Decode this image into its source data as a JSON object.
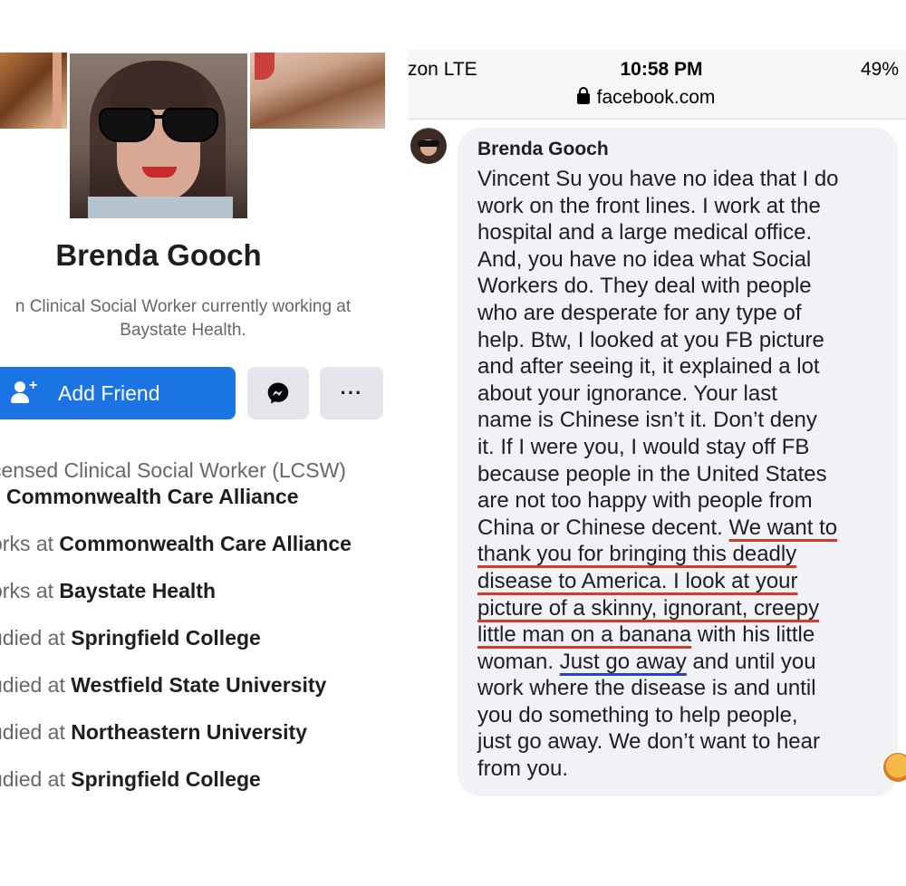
{
  "profile": {
    "name": "Brenda Gooch",
    "bio_line1": "n Clinical Social Worker currently working at",
    "bio_line2": "Baystate Health.",
    "add_friend_label": "Add Friend",
    "more_label": "···",
    "icons": {
      "add_friend": "person-plus-icon",
      "messenger": "messenger-icon",
      "more": "more-icon"
    },
    "colors": {
      "primary_button": "#1b74e4",
      "secondary_button": "#e4e6eb"
    },
    "about": [
      {
        "prefix": "censed Clinical Social Worker (LCSW)",
        "value": ""
      },
      {
        "prefix": "",
        "value": "Commonwealth Care Alliance"
      },
      {
        "prefix": "orks at ",
        "value": "Commonwealth Care Alliance"
      },
      {
        "prefix": "orks at ",
        "value": "Baystate Health"
      },
      {
        "prefix": "udied at ",
        "value": "Springfield College"
      },
      {
        "prefix": "udied at ",
        "value": "Westfield State University"
      },
      {
        "prefix": "udied at ",
        "value": "Northeastern University"
      },
      {
        "prefix": "udied at ",
        "value": "Springfield College"
      }
    ]
  },
  "statusbar": {
    "carrier": "zon  LTE",
    "time": "10:58 PM",
    "battery": "49%",
    "url": "facebook.com"
  },
  "comment": {
    "author": "Brenda Gooch",
    "lines": {
      "l1": "Vincent Su you have no idea that I do",
      "l2": "work on the front lines. I work at the",
      "l3": "hospital and a large medical office.",
      "l4": "And, you have no idea what Social",
      "l5": "Workers do. They deal with people",
      "l6": "who are desperate for any type of",
      "l7": "help. Btw, I looked at you FB picture",
      "l8": "and after seeing it, it explained a lot",
      "l9": "about your ignorance. Your last",
      "l10": "name is Chinese isn’t it. Don’t deny",
      "l11": "it. If I were you, I would stay off FB",
      "l12": "because people in the United States",
      "l13": "are not too happy with people from",
      "l14a": "China or Chinese decent. ",
      "l14b": "We want to",
      "l15": "thank you for bringing this deadly",
      "l16": "disease to America. I look at your",
      "l17": "picture of a skinny, ignorant, creepy",
      "l18a": "little man on a banana",
      "l18b": " with his little",
      "l19a": "woman. ",
      "l19b": "Just go away",
      "l19c": " and until you",
      "l20": "work where the disease is and until",
      "l21": "you do something to help people,",
      "l22": "just go away. We don’t want to hear",
      "l23": "from you."
    },
    "underline_colors": {
      "red": "#d23a2e",
      "blue": "#2c3fd1"
    }
  }
}
